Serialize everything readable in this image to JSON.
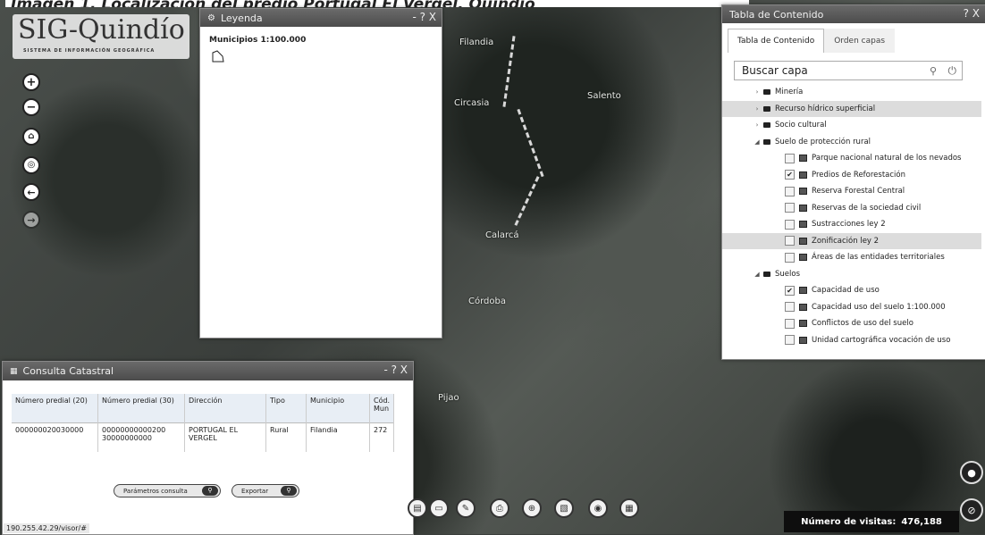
{
  "caption": "Imagen 1. Localización del predio Portugal El Vergel, Quindío",
  "logo": {
    "title": "SIG-Quindío",
    "subtitle": "SISTEMA DE INFORMACIÓN GEOGRÁFICA"
  },
  "map_labels": [
    "Filandia",
    "Salento",
    "Circasia",
    "Calarcá",
    "Córdoba",
    "Pijao"
  ],
  "zoom_controls": [
    "zoom-in-icon",
    "zoom-out-icon",
    "home-icon",
    "locate-icon",
    "back-arrow-icon",
    "forward-arrow-icon"
  ],
  "legend_panel": {
    "title": "Leyenda",
    "controls": "- ? X",
    "item": "Municipios 1:100.000"
  },
  "toc_panel": {
    "title": "Tabla de Contenido",
    "controls": "? X",
    "tabs": [
      "Tabla de Contenido",
      "Orden capas"
    ],
    "search_placeholder": "Buscar capa",
    "items": [
      {
        "label": "Minería",
        "type": "folder",
        "level": 0,
        "expanded": false
      },
      {
        "label": "Recurso hídrico superficial",
        "type": "folder",
        "level": 0,
        "expanded": false,
        "highlight": true
      },
      {
        "label": "Socio cultural",
        "type": "folder",
        "level": 0,
        "expanded": false
      },
      {
        "label": "Suelo de protección rural",
        "type": "folder",
        "level": 0,
        "expanded": true
      },
      {
        "label": "Parque nacional natural de los nevados",
        "type": "layer",
        "level": 1,
        "checked": false
      },
      {
        "label": "Predios de Reforestación",
        "type": "layer",
        "level": 1,
        "checked": true
      },
      {
        "label": "Reserva Forestal Central",
        "type": "layer",
        "level": 1,
        "checked": false
      },
      {
        "label": "Reservas de la sociedad civil",
        "type": "layer",
        "level": 1,
        "checked": false
      },
      {
        "label": "Sustracciones ley 2",
        "type": "layer",
        "level": 1,
        "checked": false
      },
      {
        "label": "Zonificación ley 2",
        "type": "layer",
        "level": 1,
        "checked": false,
        "highlight": true
      },
      {
        "label": "Áreas de las entidades territoriales",
        "type": "layer",
        "level": 1,
        "checked": false
      },
      {
        "label": "Suelos",
        "type": "folder",
        "level": 0,
        "expanded": true
      },
      {
        "label": "Capacidad de uso",
        "type": "layer",
        "level": 1,
        "checked": true
      },
      {
        "label": "Capacidad uso del suelo 1:100.000",
        "type": "layer",
        "level": 1,
        "checked": false
      },
      {
        "label": "Conflictos de uso del suelo",
        "type": "layer",
        "level": 1,
        "checked": false
      },
      {
        "label": "Unidad cartográfica vocación de uso",
        "type": "layer",
        "level": 1,
        "checked": false
      }
    ]
  },
  "catastral_panel": {
    "title": "Consulta Catastral",
    "controls": "- ? X",
    "headers": [
      "Número predial (20)",
      "Número predial (30)",
      "Dirección",
      "Tipo",
      "Municipio",
      "Cód. Mun"
    ],
    "rows": [
      [
        "000000020030000",
        "00000000000200 30000000000",
        "PORTUGAL EL VERGEL",
        "Rural",
        "Filandia",
        "272"
      ]
    ],
    "buttons": [
      "Parámetros consulta",
      "Exportar"
    ]
  },
  "toolbar_icons": [
    "layers-icon",
    "folder-icon",
    "draw-icon",
    "print-icon",
    "measure-icon",
    "map-icon",
    "location-icon",
    "table-icon"
  ],
  "visits": {
    "label": "Número de visitas:",
    "value": "476,188"
  },
  "coords": "190.255.42.29/visor/#"
}
